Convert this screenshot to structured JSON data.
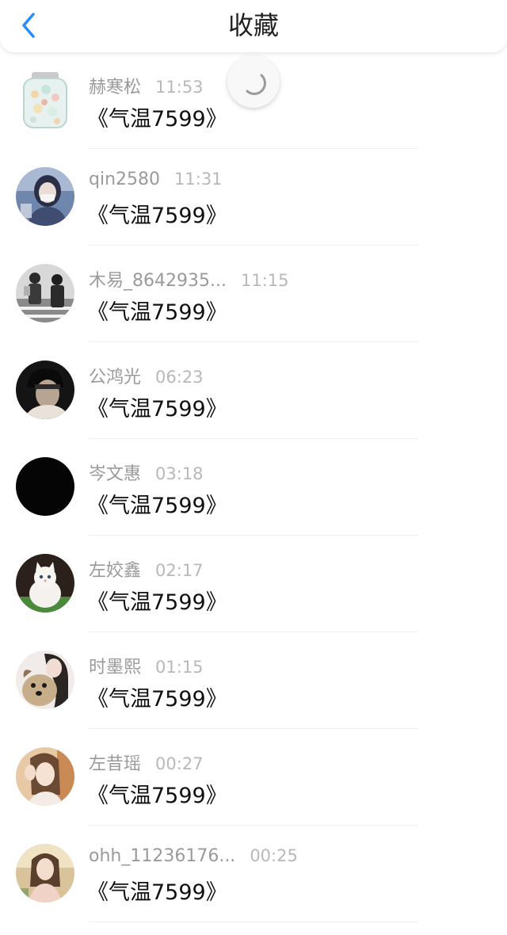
{
  "header": {
    "title": "收藏",
    "back_icon": "chevron-left-icon",
    "accent_color": "#2a8cff"
  },
  "loading_indicator": {
    "icon": "loading-spinner-icon"
  },
  "favorites": [
    {
      "name": "赫寒松",
      "time": "11:53",
      "title": "《气温7599》",
      "avatar": "glass-jar-avatar"
    },
    {
      "name": "qin2580",
      "time": "11:31",
      "title": "《气温7599》",
      "avatar": "masked-girl-avatar"
    },
    {
      "name": "木易_8642935...",
      "time": "11:15",
      "title": "《气温7599》",
      "avatar": "street-photo-avatar"
    },
    {
      "name": "公鸿光",
      "time": "06:23",
      "title": "《气温7599》",
      "avatar": "dark-portrait-avatar"
    },
    {
      "name": "岑文惠",
      "time": "03:18",
      "title": "《气温7599》",
      "avatar": "black-avatar"
    },
    {
      "name": "左姣鑫",
      "time": "02:17",
      "title": "《气温7599》",
      "avatar": "white-cat-avatar"
    },
    {
      "name": "时墨熙",
      "time": "01:15",
      "title": "《气温7599》",
      "avatar": "girl-with-dog-avatar"
    },
    {
      "name": "左昔瑶",
      "time": "00:27",
      "title": "《气温7599》",
      "avatar": "girl-waving-avatar"
    },
    {
      "name": "ohh_11236176...",
      "time": "00:25",
      "title": "《气温7599》",
      "avatar": "girl-portrait-avatar"
    }
  ]
}
